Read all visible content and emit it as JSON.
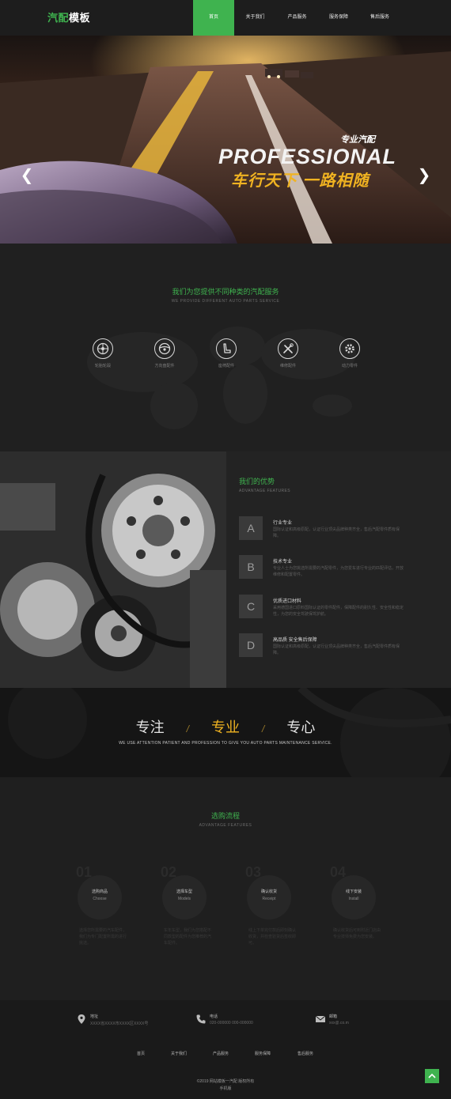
{
  "header": {
    "logo_green": "汽配",
    "logo_white": "模板",
    "nav": [
      "首页",
      "关于我们",
      "产品服务",
      "服务保障",
      "售后服务"
    ]
  },
  "hero": {
    "sub": "专业汽配",
    "title": "PROFESSIONAL",
    "slogan": "车行天下 一路相随"
  },
  "services": {
    "title": "我们为您提供不同种类的汽配服务",
    "subtitle": "WE PROVIDE DIFFERENT  AUTO PARTS SERVICE",
    "items": [
      {
        "label": "轮胎轮毂",
        "icon": "wheel-icon"
      },
      {
        "label": "方向盘配件",
        "icon": "steering-wheel-icon"
      },
      {
        "label": "座椅配件",
        "icon": "seat-icon"
      },
      {
        "label": "维修配件",
        "icon": "tools-icon"
      },
      {
        "label": "动力零件",
        "icon": "gear-icon"
      }
    ]
  },
  "advantages": {
    "title": "我们的优势",
    "subtitle": "ADVANTAGE FEATURES",
    "items": [
      {
        "letter": "A",
        "head": "行业专业",
        "text": "国际认证和高级原配，认证行业顶尖品牌种类齐全，售后汽配零件质有保障。"
      },
      {
        "letter": "B",
        "head": "技术专业",
        "text": "专业人士为您挑选所需要的汽配零件，为您爱车进行专业的匹配评估，开放维修和配置零件。"
      },
      {
        "letter": "C",
        "head": "优质进口材料",
        "text": "采用德国进口原料国际认证的零件配件，保障配件的耐久性、安全性和稳定性，为您的安全驾驶保驾护航。"
      },
      {
        "letter": "D",
        "head": "高品质 安全售后保障",
        "text": "国际认证和高级原配，认证行业顶尖品牌种类齐全，售后汽配零件质有保障。"
      }
    ]
  },
  "banner": {
    "words": [
      "专注",
      "专业",
      "专心"
    ],
    "text": "WE USE ATTENTION PATIENT AND  PROFESSION TO GIVE YOU AUTO PARTS  MAINTENANCE SERVICE."
  },
  "process": {
    "title": "选购流程",
    "subtitle": "ADVANTAGE FEATURES",
    "steps": [
      {
        "num": "01",
        "cn": "选购商品",
        "en": "Choose",
        "text": "选择您所需要的汽车配件，我们为专门配置所需的进行挑选。"
      },
      {
        "num": "02",
        "cn": "选择车型",
        "en": "Models",
        "text": "车年车型，我们为您搭配不同款型的配件为您推荐的汽车配件。"
      },
      {
        "num": "03",
        "cn": "确认收货",
        "en": "Receipt",
        "text": "线上下单完付款后即刻确认收货，并检查验货后签收即可。"
      },
      {
        "num": "04",
        "cn": "线下安装",
        "en": "Install",
        "text": "确认收货后可到附近门店由专业技师免费为您安装。"
      }
    ]
  },
  "footer": {
    "contacts": [
      {
        "label": "地址",
        "value": "XXXX省XXXX市XXXX区XXXX号",
        "icon": "location-pin-icon"
      },
      {
        "label": "电话",
        "value": "020-000000 000-000000",
        "icon": "phone-icon"
      },
      {
        "label": "邮箱",
        "value": "xxx@.co.m",
        "icon": "mail-icon"
      }
    ],
    "nav": [
      "首页",
      "关于我们",
      "产品服务",
      "服务保障",
      "售后服务"
    ],
    "copyright": "©2019 网站模板一汽配 版权所有",
    "mobile": "手机版"
  },
  "colors": {
    "accent": "#3fb34f",
    "gold": "#f0b321",
    "background": "#1f1f1f"
  }
}
